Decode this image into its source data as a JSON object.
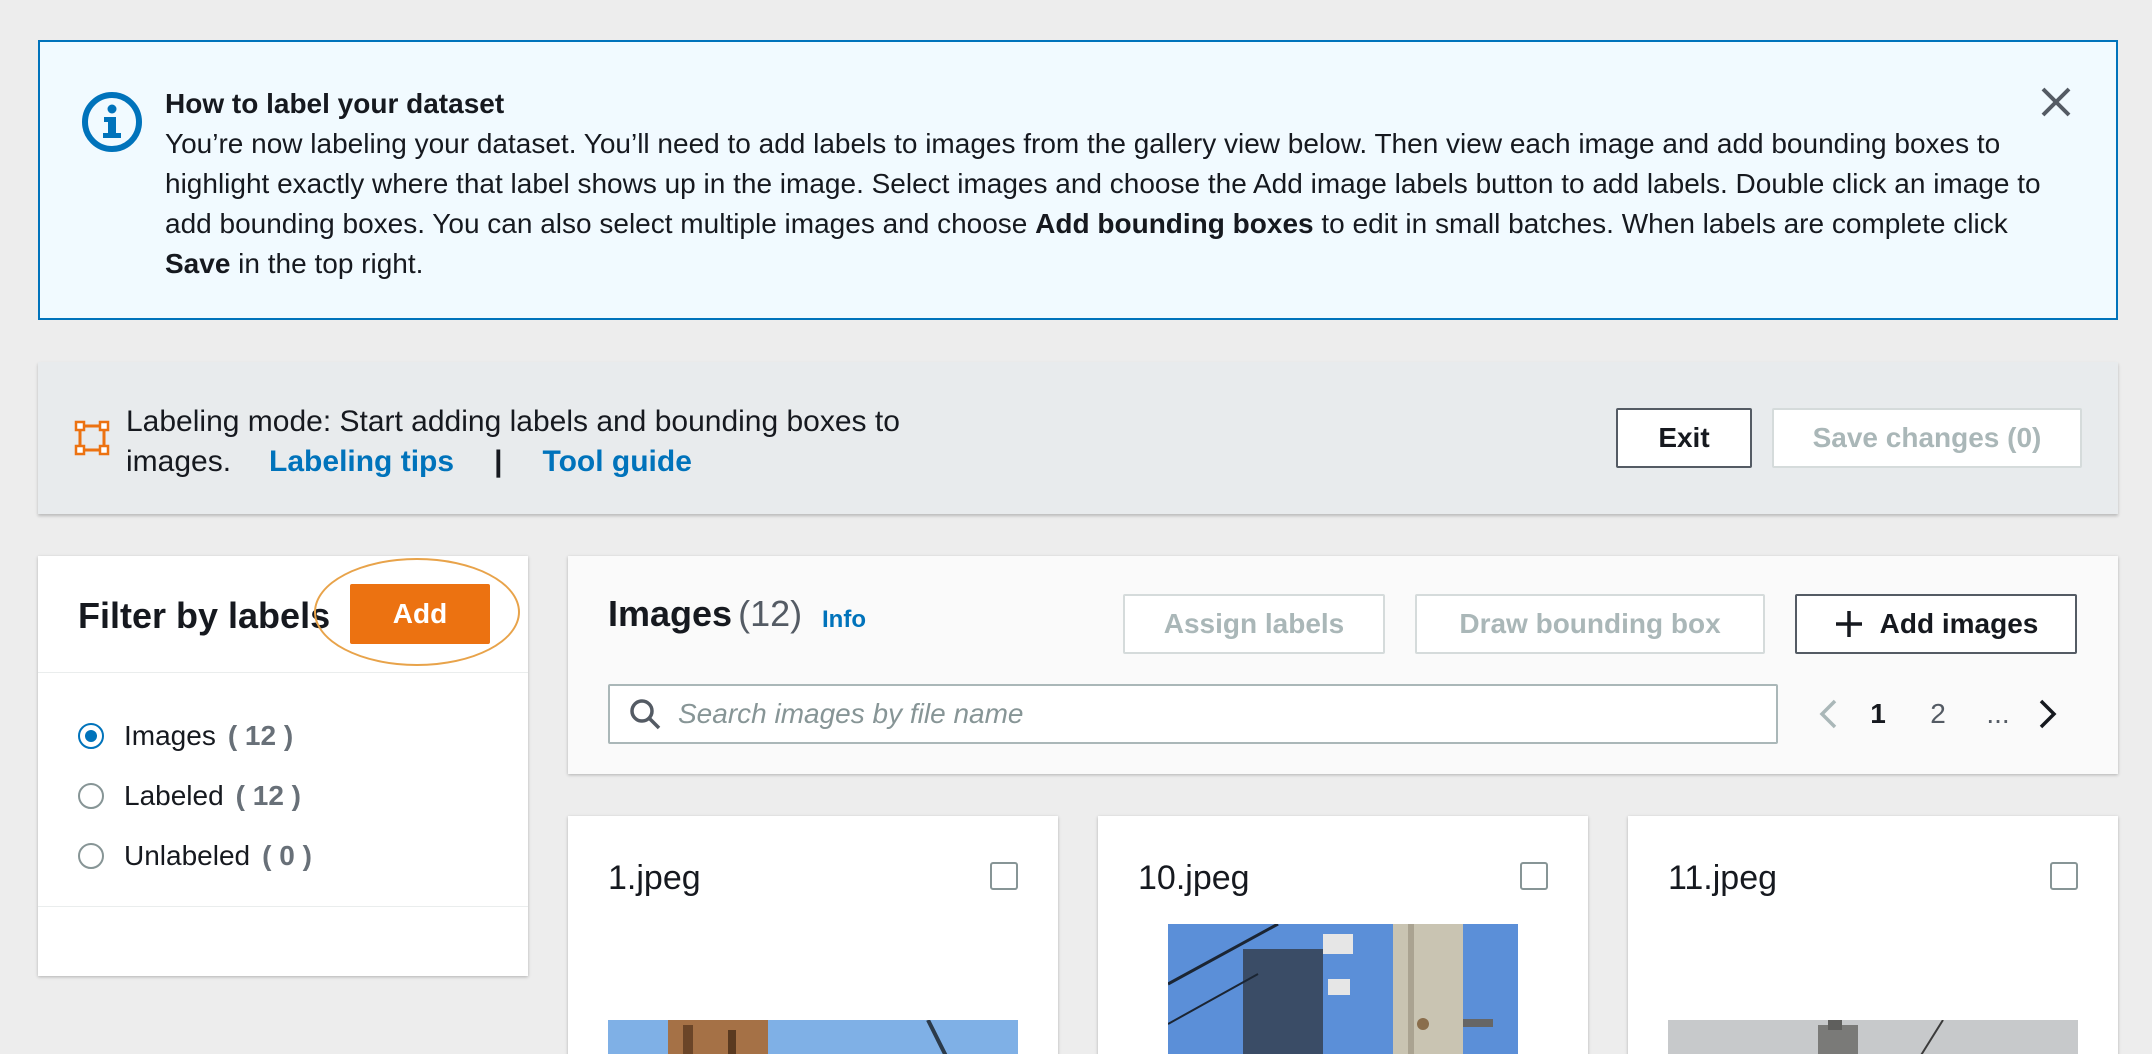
{
  "banner": {
    "title": "How to label your dataset",
    "body_1": "You’re now labeling your dataset. You’ll need to add labels to images from the gallery view below. Then view each image and add bounding boxes to highlight exactly where that label shows up in the image. Select images and choose the Add image labels button to add labels. Double click an image to add bounding boxes. You can also select multiple images and choose ",
    "body_bold_1": "Add bounding boxes",
    "body_2": " to edit in small batches. When labels are complete click ",
    "body_bold_2": "Save",
    "body_3": " in the top right.",
    "accent_color": "#0073bb"
  },
  "mode": {
    "text": "Labeling mode: Start adding labels and bounding boxes to images.",
    "tips_link": "Labeling tips",
    "separator": "|",
    "guide_link": "Tool guide",
    "exit_label": "Exit",
    "save_label": "Save changes (0)"
  },
  "filter": {
    "title": "Filter by labels",
    "add_label": "Add",
    "add_color": "#ec7211",
    "options": [
      {
        "label": "Images",
        "count": "( 12 )",
        "selected": true
      },
      {
        "label": "Labeled",
        "count": "( 12 )",
        "selected": false
      },
      {
        "label": "Unlabeled",
        "count": "( 0 )",
        "selected": false
      }
    ]
  },
  "images": {
    "title": "Images",
    "count": "(12)",
    "info_link": "Info",
    "assign_label": "Assign labels",
    "draw_label": "Draw bounding box",
    "add_images_label": "Add images",
    "search_placeholder": "Search images by file name",
    "pages": [
      "1",
      "2",
      "..."
    ],
    "current_page": "1"
  },
  "cards": [
    {
      "name": "1.jpeg"
    },
    {
      "name": "10.jpeg"
    },
    {
      "name": "11.jpeg"
    }
  ],
  "icons": {
    "info": "info-circle-icon",
    "close": "close-icon",
    "bbox": "bounding-box-icon",
    "search": "search-icon",
    "prev": "chevron-left-icon",
    "next": "chevron-right-icon",
    "plus": "plus-icon"
  }
}
